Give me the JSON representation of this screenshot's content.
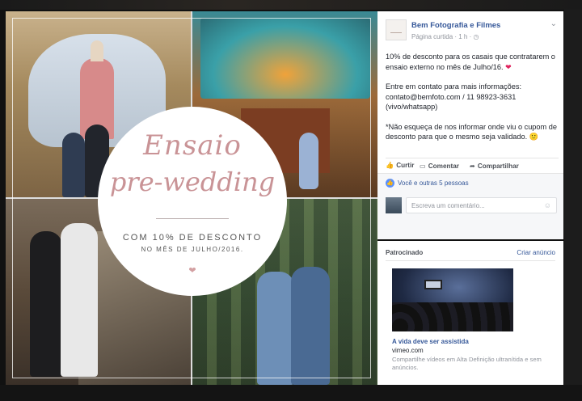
{
  "post": {
    "page_name": "Bem Fotografia e Filmes",
    "page_meta": "Página curtida · 1 h · ◷",
    "paragraph_1": "10% de desconto para os casais que contratarem o ensaio externo no mês de Julho/16.",
    "paragraph_1_emoji": "❤",
    "paragraph_2_line_1": "Entre em contato para mais informações:",
    "paragraph_2_line_2": "contato@bemfoto.com / 11 98923-3631",
    "paragraph_2_line_3": "(vivo/whatsapp)",
    "paragraph_3": "*Não esqueça de nos informar onde viu o cupom de desconto para que o mesmo seja validado.",
    "paragraph_3_emoji": "🙂",
    "actions": {
      "like": "Curtir",
      "comment": "Comentar",
      "share": "Compartilhar"
    },
    "likes_text": "Você e outras 5 pessoas",
    "comment_placeholder": "Escreva um comentário..."
  },
  "collage": {
    "script_line_1": "Ensaio",
    "script_line_2": "pre-wedding",
    "discount": "COM 10% DE DESCONTO",
    "month": "NO MÊS DE JULHO/2016."
  },
  "sponsored": {
    "header": "Patrocinado",
    "create_ad": "Criar anúncio",
    "title": "A vida deve ser assistida",
    "domain": "vimeo.com",
    "description": "Compartilhe vídeos em Alta Definição ultranítida e sem anúncios."
  },
  "icons": {
    "menu": "chevron-down-icon",
    "like": "thumb-up-icon",
    "comment": "speech-bubble-icon",
    "share": "share-arrow-icon",
    "likes_badge": "like-badge-icon",
    "emoji_picker": "smiley-icon",
    "divider_heart": "heart-icon"
  },
  "colors": {
    "link_blue": "#365899",
    "script_pink": "#c99396",
    "like_blue": "#5890ff"
  }
}
